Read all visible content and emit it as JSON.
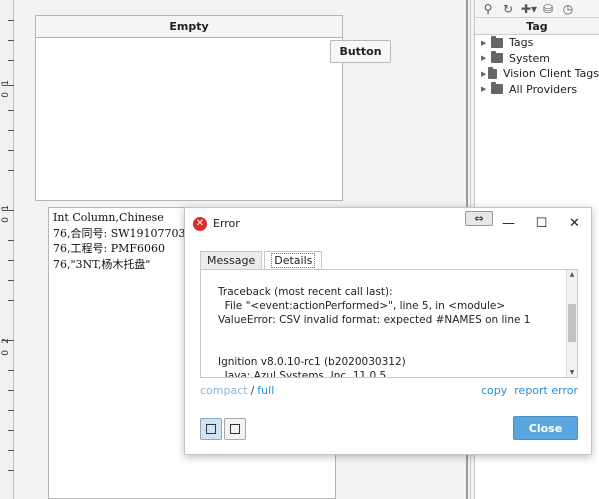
{
  "ruler": {
    "labels": [
      "1",
      "0",
      "1",
      "0",
      "2",
      "0"
    ]
  },
  "table": {
    "header": "Empty"
  },
  "button_component": {
    "label": "Button"
  },
  "textarea": {
    "lines": [
      "Int Column,Chinese",
      "76,合同号: SW19107703",
      "76,工程号: PMF6060",
      "76,\"3NT,杨木托盘\""
    ]
  },
  "tag_browser": {
    "toolbar_icons": [
      "search-icon",
      "refresh-icon",
      "add-tag-icon",
      "database-icon",
      "clock-icon"
    ],
    "header": "Tag",
    "items": [
      {
        "label": "Tags"
      },
      {
        "label": "System"
      },
      {
        "label": "Vision Client Tags"
      },
      {
        "label": "All Providers"
      }
    ]
  },
  "dialog": {
    "title": "Error",
    "resize_glyph": "⇔",
    "minimize": "—",
    "maximize": "☐",
    "close": "✕",
    "tabs": [
      {
        "label": "Message",
        "active": false
      },
      {
        "label": "Details",
        "active": true
      }
    ],
    "details_text": "Traceback (most recent call last):\n  File \"<event:actionPerformed>\", line 5, in <module>\nValueError: CSV invalid format: expected #NAMES on line 1\n\n\nIgnition v8.0.10-rc1 (b2020030312)\n  Java: Azul Systems, Inc. 11.0.5",
    "links": {
      "compact": "compact",
      "separator": "/",
      "full": "full",
      "copy": "copy",
      "report": "report error"
    },
    "close_button": "Close"
  },
  "colors": {
    "accent": "#5aa6de",
    "link": "#2a8fd6",
    "error": "#d9302c"
  }
}
